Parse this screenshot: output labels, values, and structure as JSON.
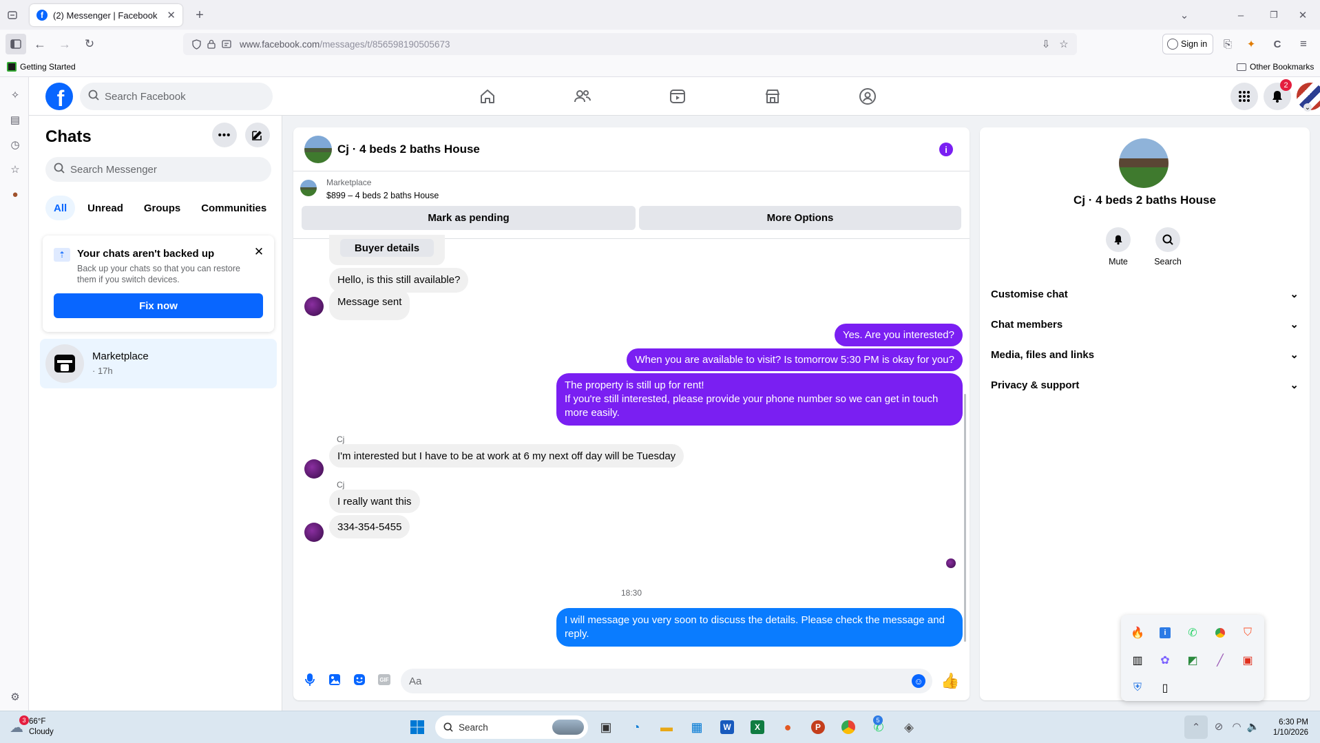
{
  "browser": {
    "tab_title": "(2) Messenger | Facebook",
    "url_host": "www.facebook.com",
    "url_path": "/messages/t/856598190505673",
    "sign_in": "Sign in",
    "bookmark_left": "Getting Started",
    "bookmark_right": "Other Bookmarks"
  },
  "fb": {
    "search_placeholder": "Search Facebook",
    "notification_count": "2"
  },
  "chats": {
    "title": "Chats",
    "search_placeholder": "Search Messenger",
    "filters": [
      "All",
      "Unread",
      "Groups",
      "Communities"
    ],
    "backup": {
      "title": "Your chats aren't backed up",
      "text": "Back up your chats so that you can restore them if you switch devices.",
      "button": "Fix now"
    },
    "items": [
      {
        "name": "Marketplace",
        "meta": "· 17h"
      }
    ]
  },
  "conversation": {
    "title": "Cj · 4 beds 2 baths House",
    "marketplace_label": "Marketplace",
    "listing": "$899 – 4 beds 2 baths House",
    "mark_pending": "Mark as pending",
    "more_options": "More Options",
    "buyer_details": "Buyer details",
    "messages": {
      "m1": "Hello, is this still available?",
      "m2": "Message sent",
      "m3": "Yes. Are you interested?",
      "m4": "When you are available to visit? Is tomorrow 5:30 PM is okay for you?",
      "m5a": "The property is still up for rent!",
      "m5b": "If you're still interested, please provide your phone number so we can get in touch more easily.",
      "sender1": "Cj",
      "m6": "I'm interested but I have to be at work at 6 my next off day will be Tuesday",
      "sender2": "Cj",
      "m7": "I really want this",
      "m8": "334-354-5455",
      "time": "18:30",
      "m9": "I will message you very soon to discuss the details. Please check the message and reply."
    },
    "input_placeholder": "Aa"
  },
  "info": {
    "title": "Cj · 4 beds 2 baths House",
    "mute": "Mute",
    "search": "Search",
    "sections": [
      "Customise chat",
      "Chat members",
      "Media, files and links",
      "Privacy & support"
    ]
  },
  "taskbar": {
    "weather_temp": "66°F",
    "weather_desc": "Cloudy",
    "weather_badge": "3",
    "search_placeholder": "Search",
    "whatsapp_badge": "5",
    "time": "6:30 PM",
    "date": "1/10/2026"
  },
  "colors": {
    "fb_blue": "#0866ff",
    "purple_bubble": "#7a1ff2",
    "blue_bubble": "#0a7cff"
  }
}
